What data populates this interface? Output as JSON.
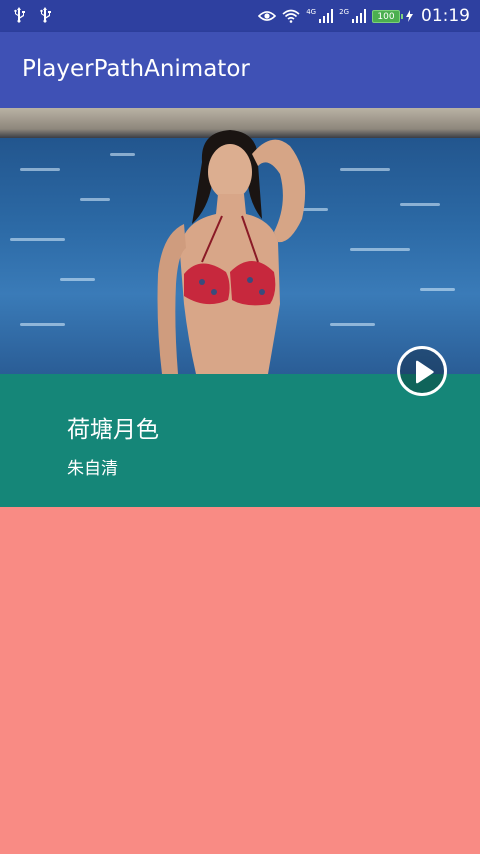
{
  "status_bar": {
    "left_icons": [
      "usb-icon",
      "usb-icon"
    ],
    "right_icons": [
      "eye-icon",
      "wifi-icon",
      "signal-4g-icon",
      "signal-2g-icon",
      "battery-icon",
      "charging-icon"
    ],
    "signal_1_label": "4G",
    "signal_2_label": "2G",
    "battery_text": "100",
    "time": "01:19"
  },
  "app_bar": {
    "title": "PlayerPathAnimator"
  },
  "player": {
    "play_icon": "play-icon",
    "song_title": "荷塘月色",
    "song_author": "朱自清"
  },
  "colors": {
    "status_bar": "#2e40a0",
    "app_bar": "#3f51b5",
    "info_panel": "#158678",
    "background": "#f98b84"
  }
}
